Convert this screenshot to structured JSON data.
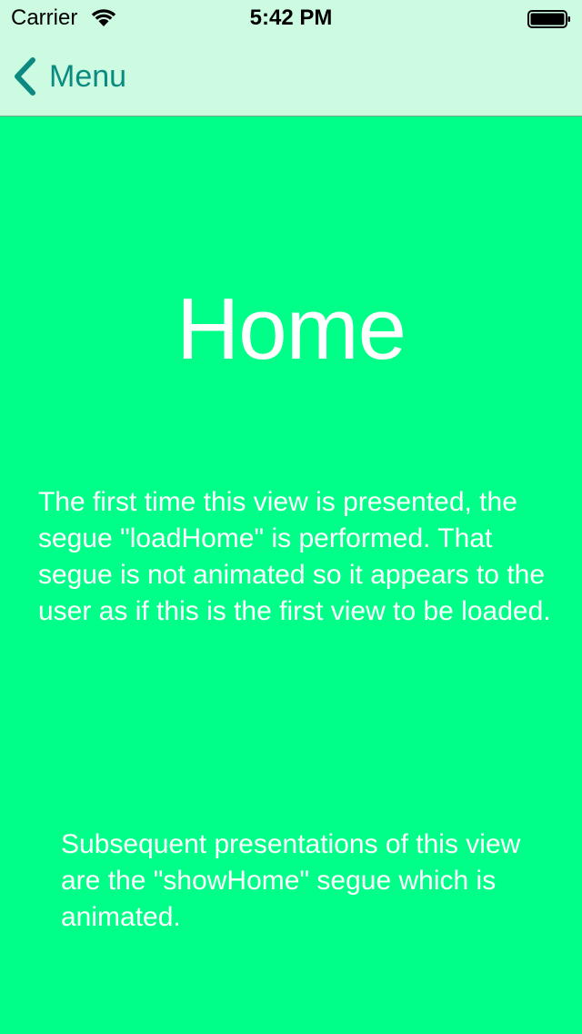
{
  "status_bar": {
    "carrier": "Carrier",
    "time": "5:42 PM"
  },
  "nav": {
    "back_label": "Menu"
  },
  "main": {
    "title": "Home",
    "description": "The first time this view is presented, the segue \"loadHome\" is performed. That segue is not animated so it appears to the user as if this is the first view to be loaded.",
    "note": "Subsequent presentations of this view are the \"showHome\" segue which is animated."
  },
  "colors": {
    "background": "#00ff88",
    "nav_background": "#ccfbe1",
    "accent": "#0b8a80",
    "text": "#ffffff"
  },
  "icons": {
    "wifi": "wifi-icon",
    "battery": "battery-icon",
    "back": "chevron-left-icon"
  }
}
